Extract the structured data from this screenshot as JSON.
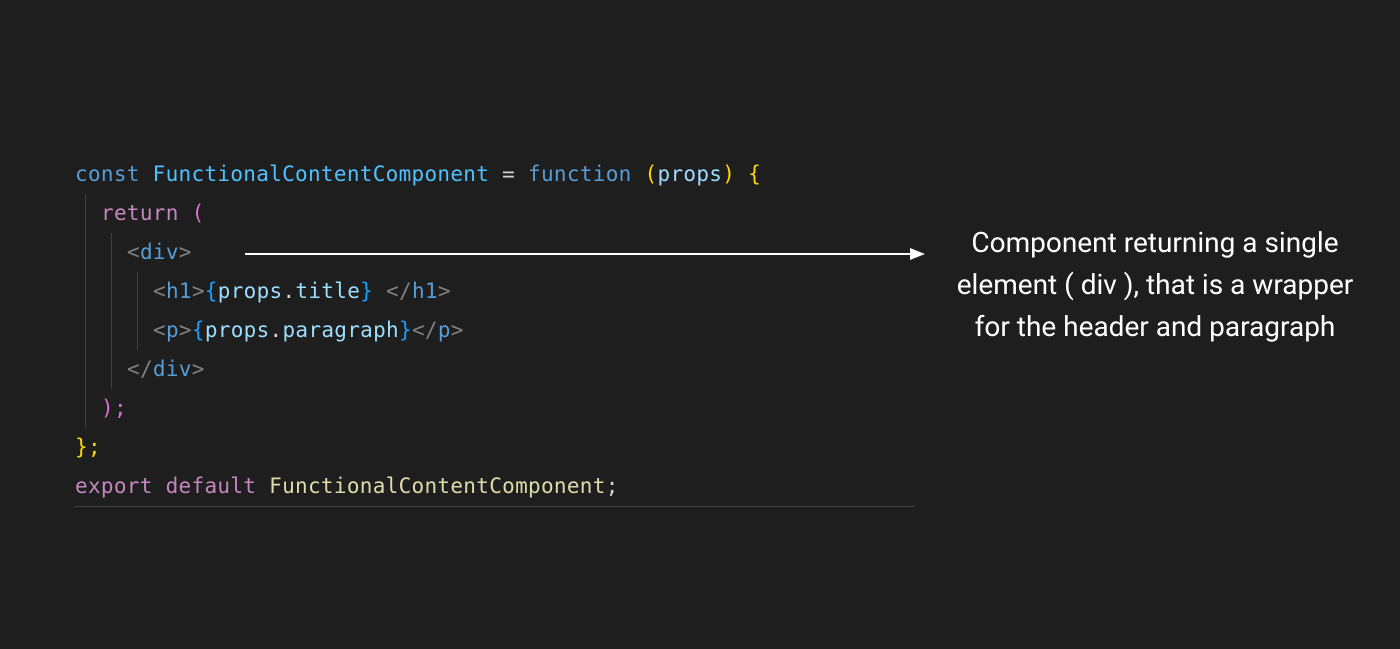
{
  "code": {
    "line1": {
      "const": "const ",
      "varname": "FunctionalContentComponent",
      "eq": " = ",
      "func": "function ",
      "open_paren": "(",
      "props": "props",
      "close_paren": ")",
      "brace": " {"
    },
    "line2": {
      "return": "return ",
      "open": "("
    },
    "line3": {
      "open": "<",
      "tag": "div",
      "close": ">"
    },
    "line4": {
      "open1": "<",
      "tag1": "h1",
      "close1": ">",
      "brace_o1": "{",
      "props": "props",
      "dot": ".",
      "title": "title",
      "brace_c1": "}",
      "space": " ",
      "open2": "</",
      "tag2": "h1",
      "close2": ">"
    },
    "line5": {
      "open1": "<",
      "tag1": "p",
      "close1": ">",
      "brace_o1": "{",
      "props": "props",
      "dot": ".",
      "para": "paragraph",
      "brace_c1": "}",
      "open2": "</",
      "tag2": "p",
      "close2": ">"
    },
    "line6": {
      "open": "</",
      "tag": "div",
      "close": ">"
    },
    "line7": ");",
    "line8": "};",
    "line9": {
      "export": "export ",
      "default": "default ",
      "name": "FunctionalContentComponent",
      "semi": ";"
    }
  },
  "annotation": "Component returning a single element ( div ), that is a wrapper for the header and paragraph"
}
